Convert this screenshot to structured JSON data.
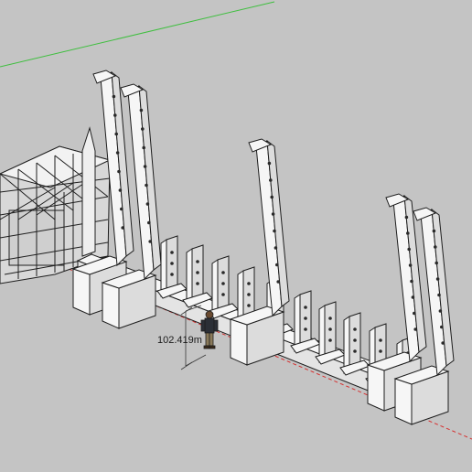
{
  "viewport": {
    "background": "#c4c4c4",
    "sky_axis_color": "#3fbf3f",
    "red_axis_color": "#d63030",
    "dimension_label": "102.419m"
  },
  "model": {
    "description_icon": "lattice-frame-structure",
    "tower_count": 5,
    "short_post_count": 12,
    "fill_color": "#f6f6f6",
    "shade_color": "#dcdcdc",
    "edge_color": "#1e1e1e"
  }
}
